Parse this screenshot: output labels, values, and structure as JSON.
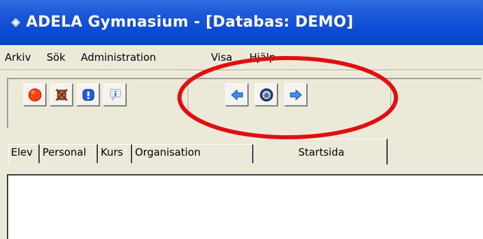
{
  "window": {
    "title": "ADELA Gymnasium - [Databas: DEMO]",
    "title_color": "#ffffff",
    "titlebar_color": "#0b4bd4"
  },
  "menu": {
    "items": [
      "Arkiv",
      "Sök",
      "Administration",
      "Visa",
      "Hjälp"
    ]
  },
  "toolbar": {
    "buttons": [
      {
        "name": "stop-button",
        "icon": "red-stop-circle-icon"
      },
      {
        "name": "exit-button",
        "icon": "crossed-figure-icon"
      },
      {
        "name": "info-button",
        "icon": "blue-exclamation-icon"
      },
      {
        "name": "help-button",
        "icon": "info-tooltip-icon"
      },
      {
        "name": "back-button",
        "icon": "arrow-left-icon"
      },
      {
        "name": "home-button",
        "icon": "home-icon"
      },
      {
        "name": "forward-button",
        "icon": "arrow-right-icon"
      }
    ],
    "highlight_color": "#e01010"
  },
  "tabs": {
    "items": [
      "Elev",
      "Personal",
      "Kurs",
      "Organisation",
      "Startsida"
    ],
    "active": "Startsida"
  }
}
